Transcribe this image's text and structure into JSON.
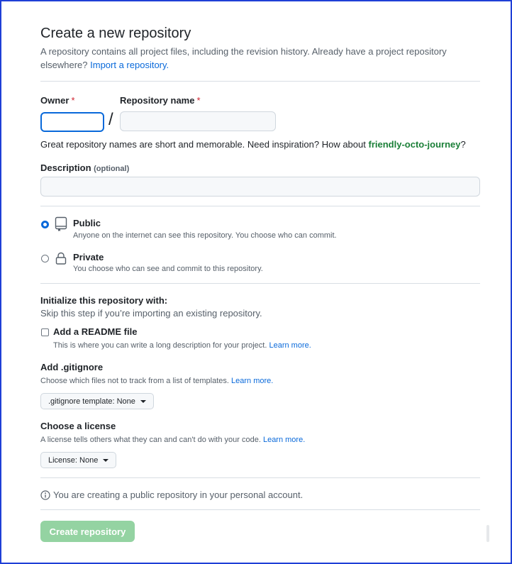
{
  "page": {
    "title": "Create a new repository",
    "subtitle_prefix": "A repository contains all project files, including the revision history. Already have a project repository elsewhere?",
    "import_link": "Import a repository."
  },
  "owner": {
    "label": "Owner",
    "required": "*",
    "value": ""
  },
  "repo_name": {
    "label": "Repository name",
    "required": "*",
    "value": ""
  },
  "separator": "/",
  "name_hint": {
    "prefix": "Great repository names are short and memorable. Need inspiration? How about",
    "suggestion": "friendly-octo-journey",
    "suffix": "?"
  },
  "description": {
    "label": "Description",
    "optional": "(optional)",
    "value": ""
  },
  "visibility": {
    "selected": "Public",
    "options": [
      {
        "title": "Public",
        "description": "Anyone on the internet can see this repository. You choose who can commit."
      },
      {
        "title": "Private",
        "description": "You choose who can see and commit to this repository."
      }
    ]
  },
  "initialize": {
    "heading": "Initialize this repository with:",
    "subheading": "Skip this step if you’re importing an existing repository.",
    "readme": {
      "label": "Add a README file",
      "description": "This is where you can write a long description for your project.",
      "link": "Learn more.",
      "checked": false
    }
  },
  "gitignore": {
    "heading": "Add .gitignore",
    "description": "Choose which files not to track from a list of templates.",
    "link": "Learn more.",
    "button": ".gitignore template: None"
  },
  "license": {
    "heading": "Choose a license",
    "description": "A license tells others what they can and can't do with your code.",
    "link": "Learn more.",
    "button": "License: None"
  },
  "notice": "You are creating a public repository in your personal account.",
  "submit": {
    "label": "Create repository",
    "enabled": false
  },
  "colors": {
    "accent": "#0969da",
    "required": "#cf222e",
    "suggestion": "#1a7f37",
    "submit_disabled": "#94d3a2",
    "frame": "#1f3fd6"
  },
  "icons": {
    "public": "repo-icon",
    "private": "lock-icon",
    "notice": "info-icon",
    "dropdown": "caret-down-icon"
  }
}
